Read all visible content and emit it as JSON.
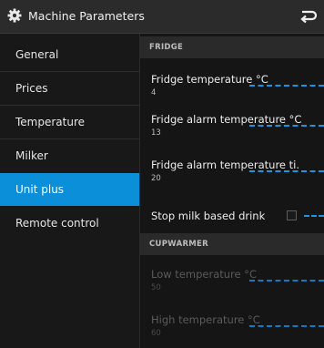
{
  "titlebar": {
    "title": "Machine Parameters",
    "settings_icon": "gear-icon",
    "back_icon": "back-arrow-icon"
  },
  "sidebar": {
    "items": [
      {
        "label": "General"
      },
      {
        "label": "Prices"
      },
      {
        "label": "Temperature"
      },
      {
        "label": "Milker"
      },
      {
        "label": "Unit plus",
        "active": true
      },
      {
        "label": "Remote control"
      }
    ]
  },
  "content": {
    "sections": [
      {
        "header": "FRIDGE",
        "settings": [
          {
            "name": "Fridge temperature °C",
            "value": "4"
          },
          {
            "name": "Fridge alarm temperature °C",
            "value": "13"
          },
          {
            "name": "Fridge alarm temperature ti.",
            "value": "20"
          }
        ],
        "toggle": {
          "name": "Stop milk based drink",
          "checked": false
        }
      },
      {
        "header": "CUPWARMER",
        "settings": [
          {
            "name": "Low temperature °C",
            "value": "50",
            "disabled": true
          },
          {
            "name": "High temperature °C",
            "value": "60",
            "disabled": true
          }
        ]
      }
    ]
  },
  "colors": {
    "accent": "#0a8fd8",
    "background": "#151515",
    "titlebar": "#2b2b2b",
    "section_header": "#2a2a2a"
  }
}
